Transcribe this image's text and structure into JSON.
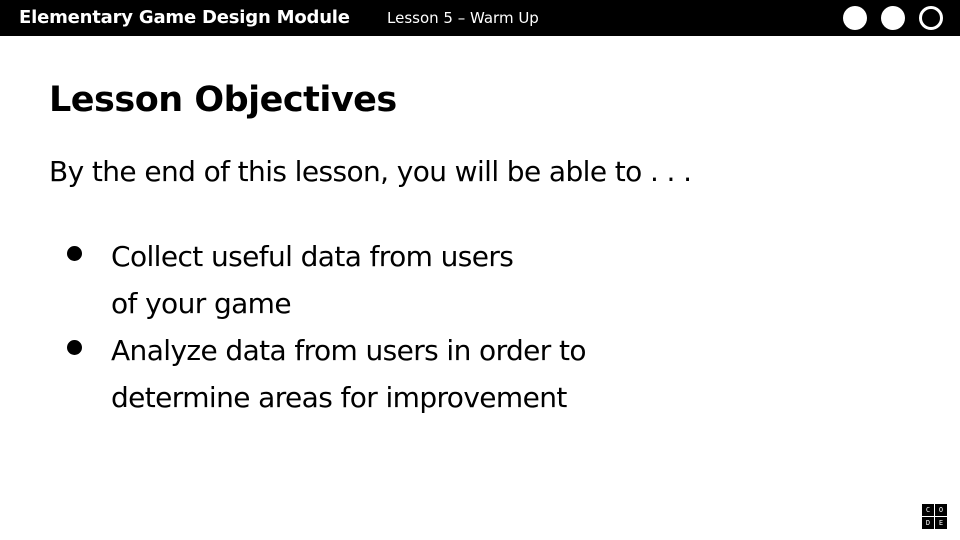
{
  "header": {
    "module_title": "Elementary Game Design Module",
    "lesson_label": "Lesson 5 – Warm Up",
    "progress_dots": [
      "filled",
      "filled",
      "empty"
    ]
  },
  "main": {
    "title": "Lesson Objectives",
    "intro": "By the end of this lesson, you will be able to . . .",
    "objectives": [
      {
        "lines": [
          "Collect useful data from users",
          "of your game"
        ]
      },
      {
        "lines": [
          "Analyze data from users in order to",
          "determine areas for improvement"
        ]
      }
    ]
  },
  "logo": {
    "letters": [
      "C",
      "O",
      "D",
      "E"
    ]
  },
  "colors": {
    "bar_background": "#000000",
    "bar_text": "#ffffff",
    "body_text": "#000000",
    "page_background": "#ffffff"
  }
}
